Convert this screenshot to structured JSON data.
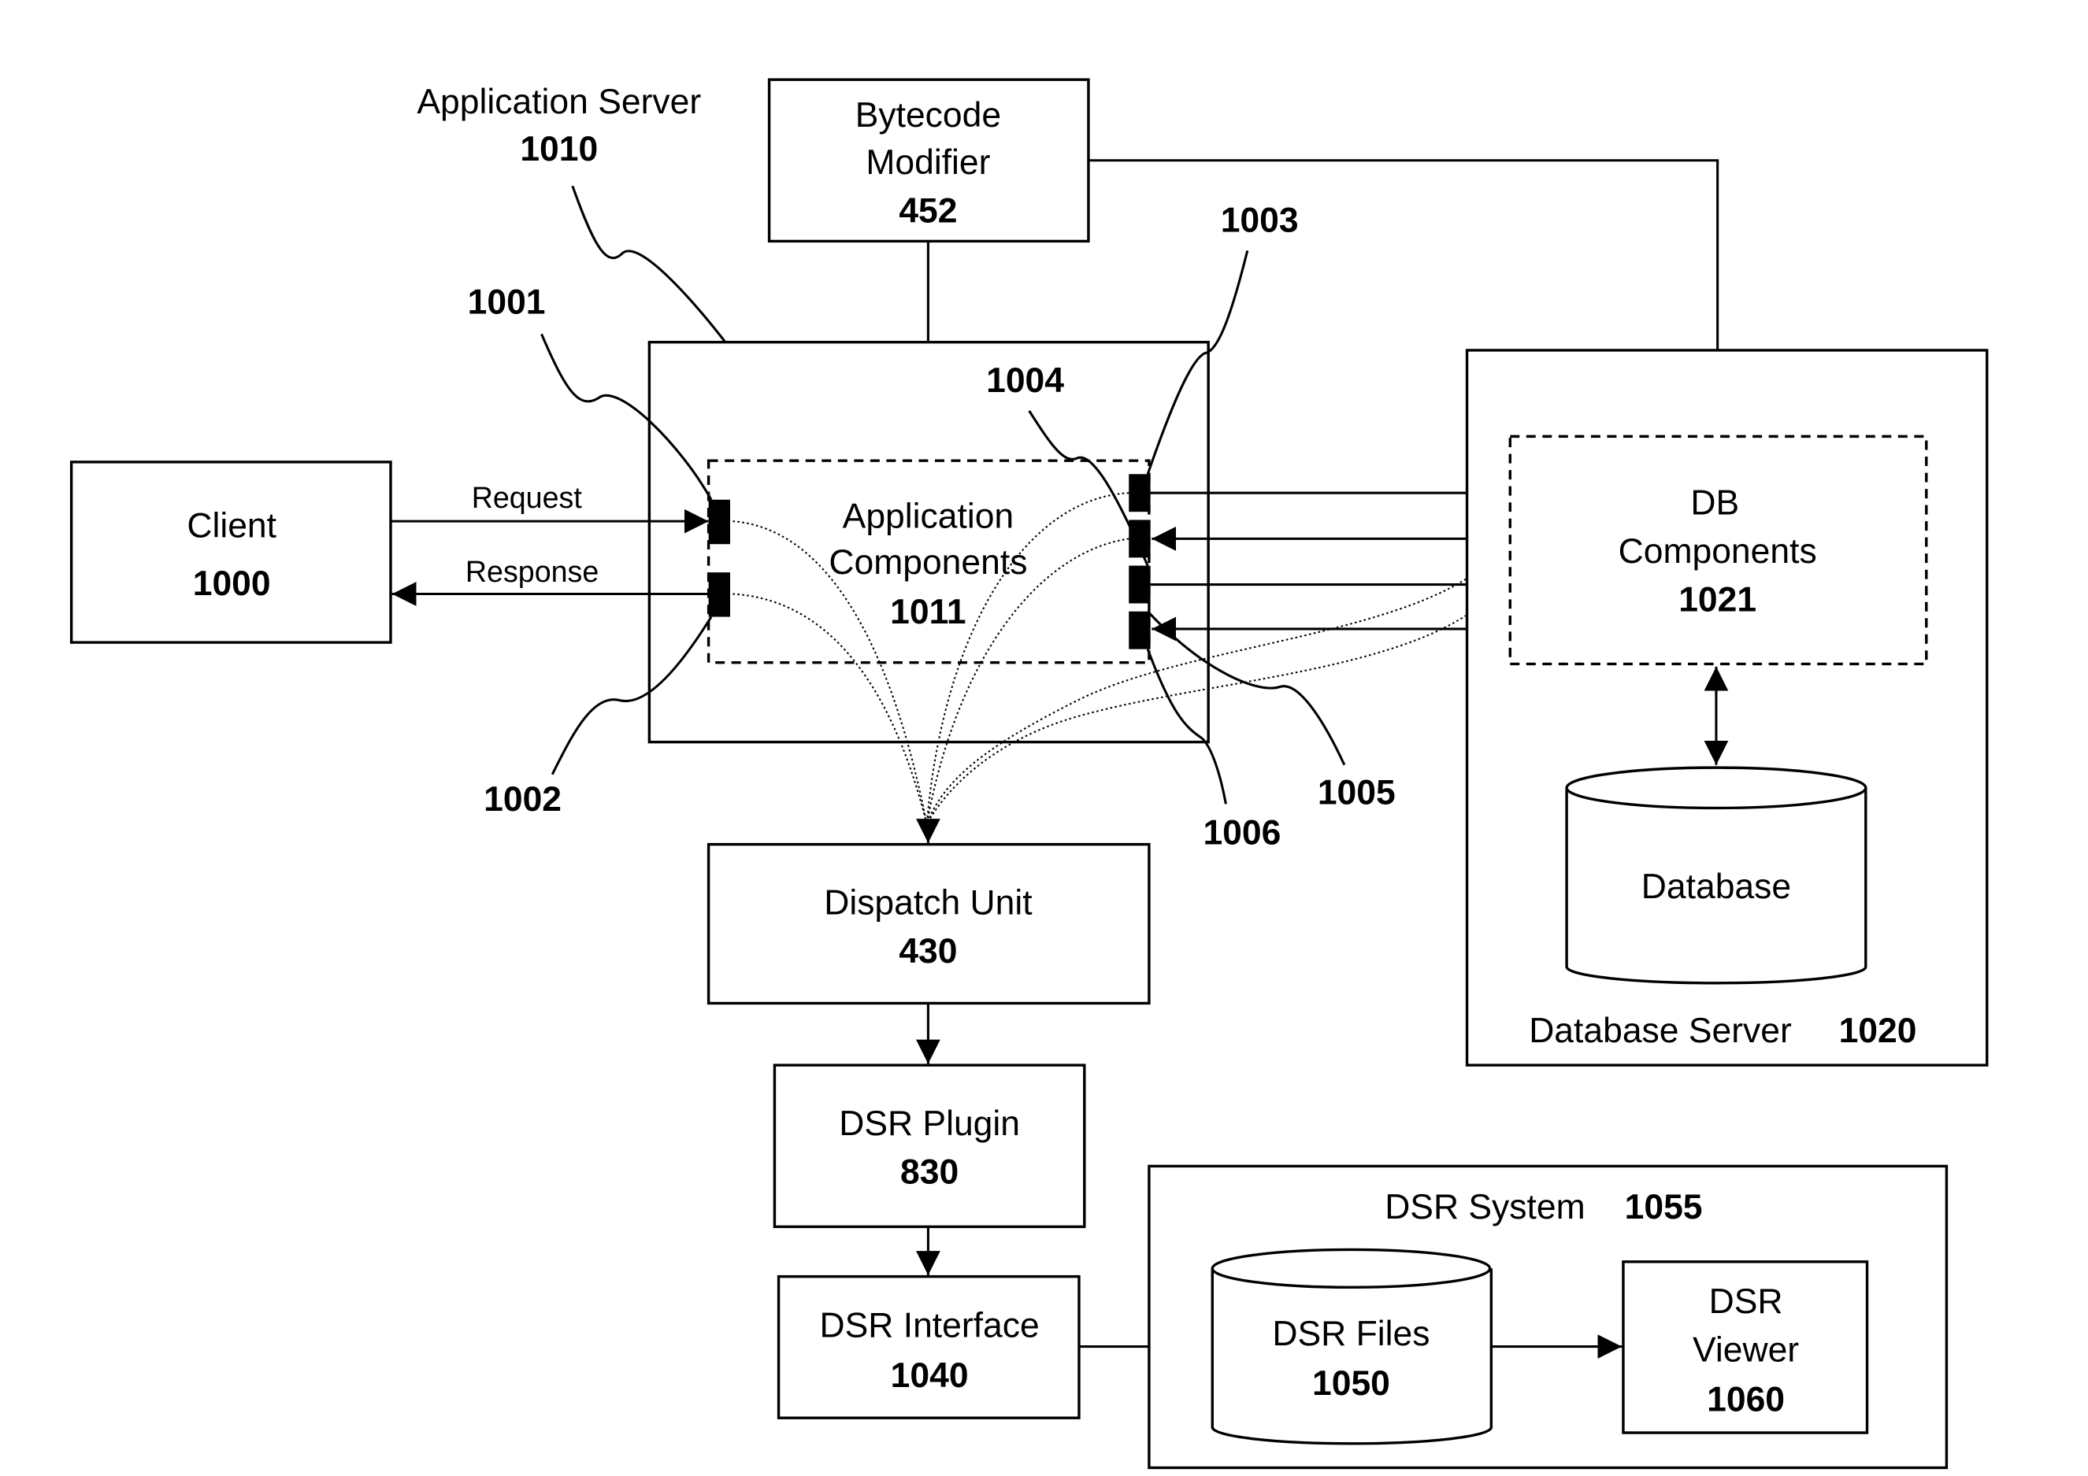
{
  "diagram": {
    "application_server": {
      "label": "Application Server",
      "ref": "1010"
    },
    "bytecode_modifier": {
      "line1": "Bytecode",
      "line2": "Modifier",
      "ref": "452"
    },
    "client": {
      "label": "Client",
      "ref": "1000"
    },
    "app_components": {
      "line1": "Application",
      "line2": "Components",
      "ref": "1011"
    },
    "db_components": {
      "line1": "DB",
      "line2": "Components",
      "ref": "1021"
    },
    "database": {
      "label": "Database"
    },
    "database_server": {
      "label": "Database Server",
      "ref": "1020"
    },
    "dispatch_unit": {
      "label": "Dispatch Unit",
      "ref": "430"
    },
    "dsr_plugin": {
      "label": "DSR Plugin",
      "ref": "830"
    },
    "dsr_interface": {
      "label": "DSR Interface",
      "ref": "1040"
    },
    "dsr_system": {
      "label": "DSR System",
      "ref": "1055"
    },
    "dsr_files": {
      "label": "DSR Files",
      "ref": "1050"
    },
    "dsr_viewer": {
      "line1": "DSR",
      "line2": "Viewer",
      "ref": "1060"
    },
    "edges": {
      "request": "Request",
      "response": "Response"
    },
    "callouts": {
      "c1001": "1001",
      "c1002": "1002",
      "c1003": "1003",
      "c1004": "1004",
      "c1005": "1005",
      "c1006": "1006"
    }
  }
}
